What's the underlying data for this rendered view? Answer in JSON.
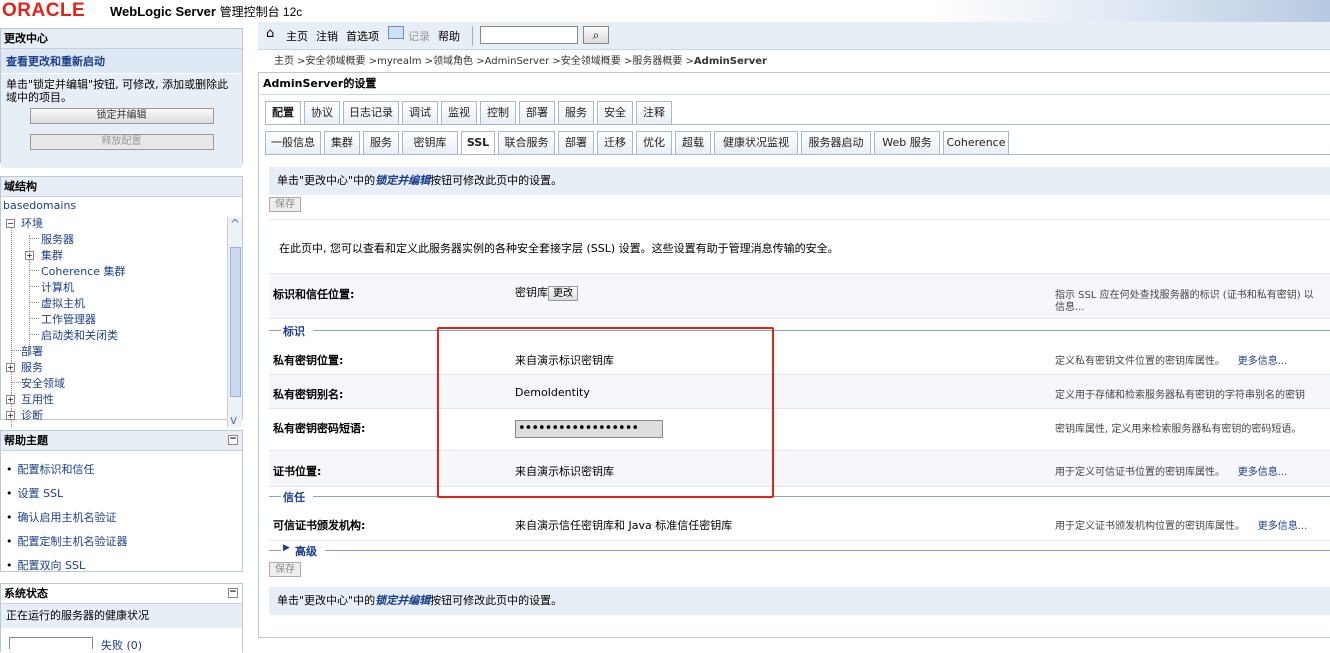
{
  "header": {
    "logo": "ORACLE",
    "product": "WebLogic Server",
    "product_sub": "管理控制台 12c"
  },
  "change_center": {
    "title": "更改中心",
    "subtitle": "查看更改和重新启动",
    "text": "单击\"锁定并编辑\"按钮, 可修改, 添加或删除此域中的项目。",
    "lock_button": "锁定并编辑",
    "release_button": "释放配置"
  },
  "domain_structure": {
    "title": "域结构",
    "root": "basedomains",
    "items": [
      "环境",
      "服务器",
      "集群",
      "Coherence 集群",
      "计算机",
      "虚拟主机",
      "工作管理器",
      "启动类和关闭类",
      "部署",
      "服务",
      "安全领域",
      "互用性",
      "诊断"
    ]
  },
  "help": {
    "title": "帮助主题",
    "items": [
      "配置标识和信任",
      "设置 SSL",
      "确认启用主机名验证",
      "配置定制主机名验证器",
      "配置双向 SSL"
    ]
  },
  "system_status": {
    "title": "系统状态",
    "subtitle": "正在运行的服务器的健康状况",
    "failed": "失败 (0)"
  },
  "nav": {
    "home": "主页",
    "logout": "注销",
    "prefs": "首选项",
    "record": "记录",
    "help": "帮助",
    "search_value": ""
  },
  "breadcrumb": {
    "path": "主页 >安全领域概要 >myrealm >领域角色 >AdminServer >安全领域概要 >服务器概要 >",
    "current": "AdminServer"
  },
  "page": {
    "title": "AdminServer的设置"
  },
  "tabs1": [
    "配置",
    "协议",
    "日志记录",
    "调试",
    "监视",
    "控制",
    "部署",
    "服务",
    "安全",
    "注释"
  ],
  "tabs2": [
    "一般信息",
    "集群",
    "服务",
    "密钥库",
    "SSL",
    "联合服务",
    "部署",
    "迁移",
    "优化",
    "超载",
    "健康状况监视",
    "服务器启动",
    "Web 服务",
    "Coherence"
  ],
  "info": {
    "prefix": "单击\"更改中心\"中的",
    "link": "锁定并编辑",
    "suffix": "按钮可修改此页中的设置。"
  },
  "save_label": "保存",
  "intro": "在此页中, 您可以查看和定义此服务器实例的各种安全套接字层 (SSL) 设置。这些设置有助于管理消息传输的安全。",
  "identity_trust": {
    "label": "标识和信任位置:",
    "value": "密钥库",
    "change_button": "更改",
    "desc": "指示 SSL 应在何处查找服务器的标识 (证书和私有密钥) 以",
    "more": "信息..."
  },
  "section_identity": "标识",
  "section_trust": "信任",
  "section_advanced": "高级",
  "fields": {
    "pk_location": {
      "label": "私有密钥位置:",
      "value": "来自演示标识密钥库",
      "desc": "定义私有密钥文件位置的密钥库属性。",
      "more": "更多信息..."
    },
    "pk_alias": {
      "label": "私有密钥别名:",
      "value": "DemoIdentity",
      "desc": "定义用于存储和检索服务器私有密钥的字符串别名的密钥"
    },
    "pk_pass": {
      "label": "私有密钥密码短语:",
      "value": "••••••••••••••••••",
      "desc": "密钥库属性, 定义用来检索服务器私有密钥的密码短语。"
    },
    "cert_location": {
      "label": "证书位置:",
      "value": "来自演示标识密钥库",
      "desc": "用于定义可信证书位置的密钥库属性。",
      "more": "更多信息..."
    },
    "trusted_ca": {
      "label": "可信证书颁发机构:",
      "value": "来自演示信任密钥库和 Java 标准信任密钥库",
      "desc": "用于定义证书颁发机构位置的密钥库属性。",
      "more": "更多信息..."
    }
  },
  "colors": {
    "accent": "#1b3f8a",
    "oracle_red": "#e2231a",
    "highlight": "#e2231a"
  }
}
